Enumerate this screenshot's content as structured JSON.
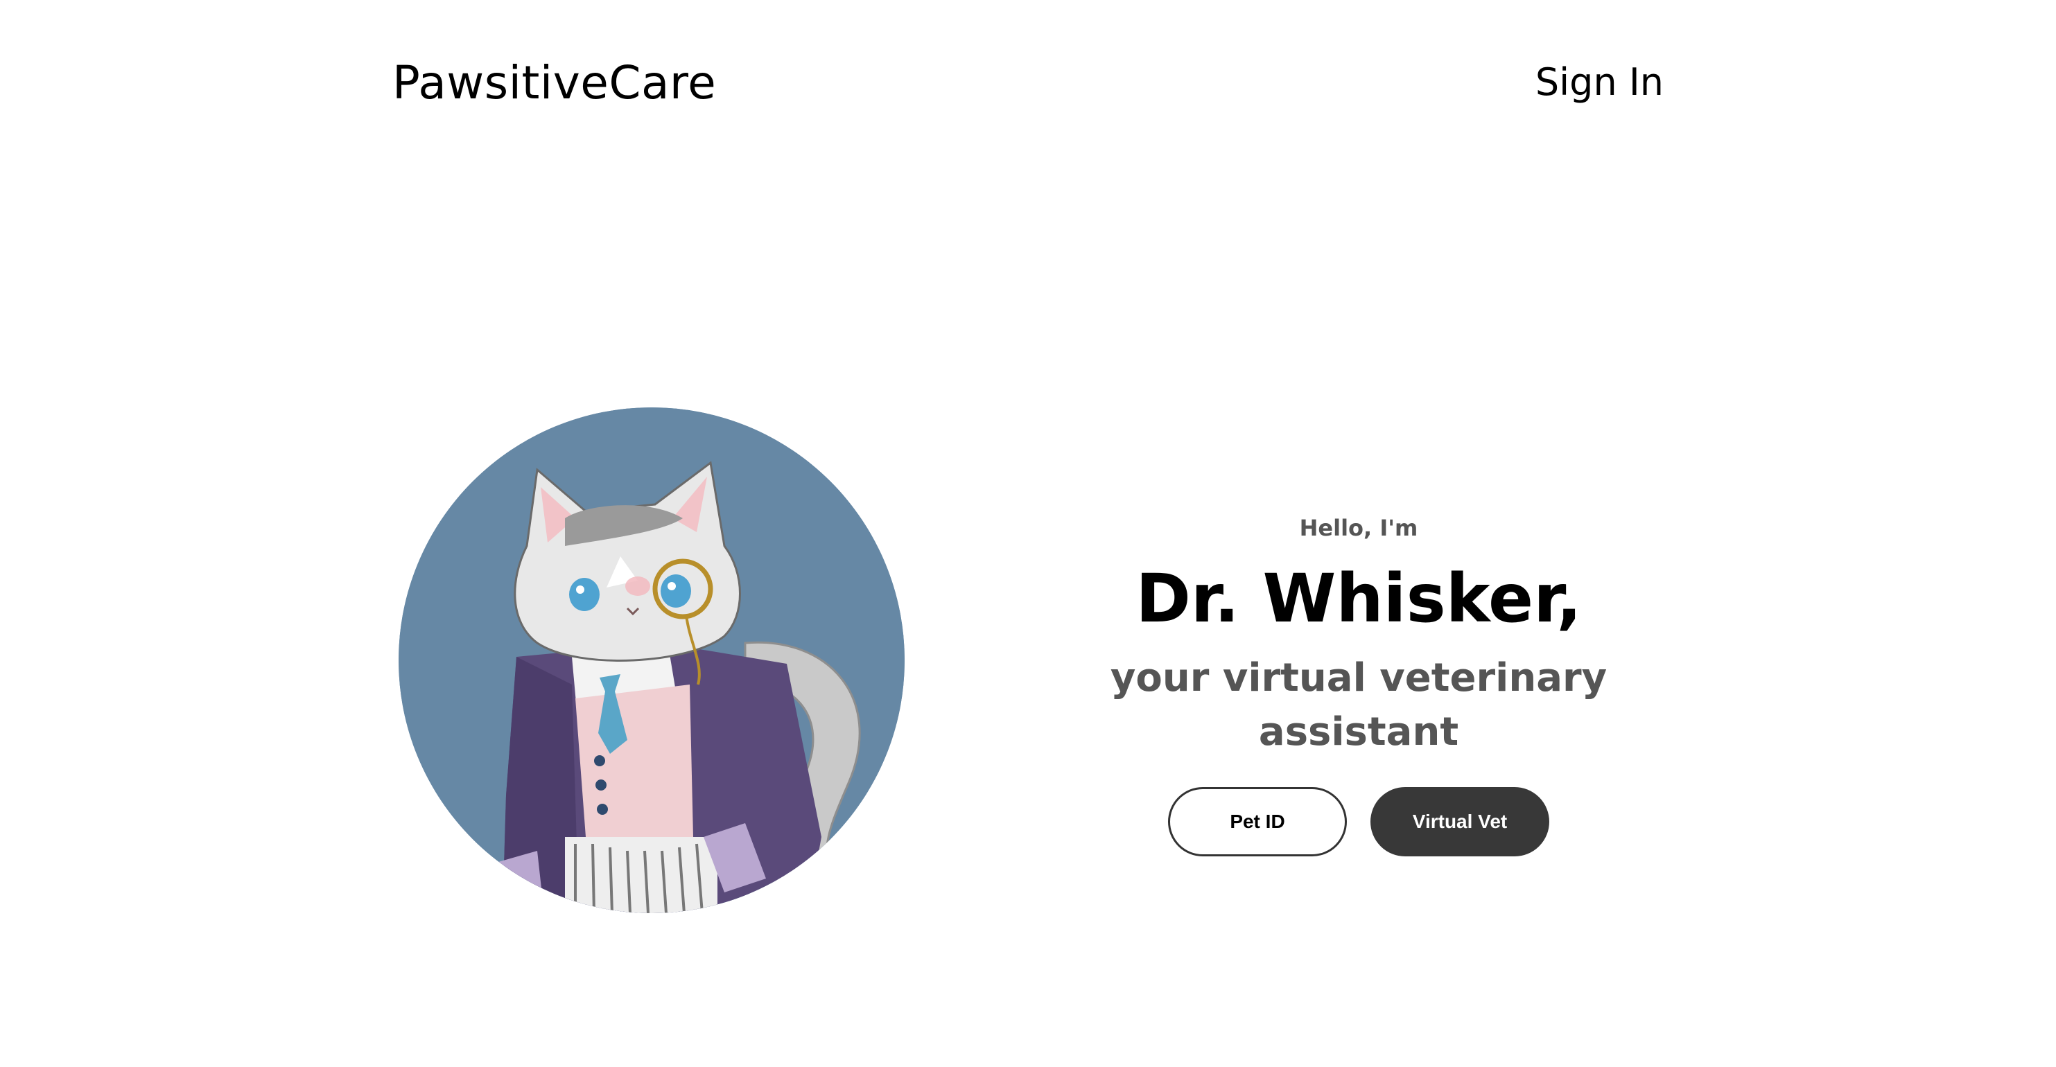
{
  "header": {
    "brand": "PawsitiveCare",
    "sign_in_label": "Sign In"
  },
  "hero": {
    "greeting": "Hello, I'm",
    "name": "Dr. Whisker,",
    "tagline": "your virtual veterinary assistant",
    "buttons": {
      "pet_id_label": "Pet ID",
      "virtual_vet_label": "Virtual Vet"
    },
    "avatar": {
      "icon": "cat-doctor-illustration",
      "background_color": "#6688a5"
    }
  },
  "colors": {
    "text_primary": "#000000",
    "text_secondary": "#555555",
    "button_dark": "#383838"
  }
}
